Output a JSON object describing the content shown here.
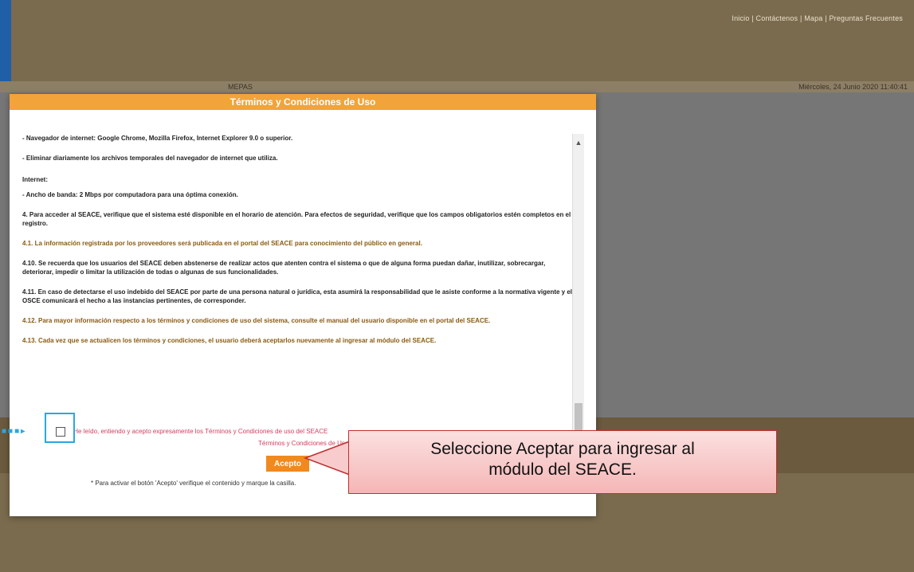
{
  "header": {
    "links": "Inicio | Contáctenos | Mapa | Preguntas Frecuentes",
    "left_label": "MEPAS",
    "date": "Miércoles, 24 Junio 2020 11:40:41"
  },
  "modal": {
    "title": "Términos y Condiciones de Uso",
    "paragraphs": [
      "- Navegador de internet: Google Chrome, Mozilla Firefox, Internet Explorer 9.0 o superior.",
      "- Eliminar diariamente los archivos temporales del navegador de internet que utiliza.",
      "Internet:",
      "- Ancho de banda: 2 Mbps por computadora para una óptima conexión.",
      "4. Para acceder al SEACE, verifique que el sistema esté disponible en el horario de atención. Para efectos de seguridad, verifique que los campos obligatorios estén completos en el registro.",
      "4.1. La información registrada por los proveedores será publicada en el portal del SEACE para conocimiento del público en general.",
      "4.10. Se recuerda que los usuarios del SEACE deben abstenerse de realizar actos que atenten contra el sistema o que de alguna forma puedan dañar, inutilizar, sobrecargar, deteriorar, impedir o limitar la utilización de todas o algunas de sus funcionalidades.",
      "4.11. En caso de detectarse el uso indebido del SEACE por parte de una persona natural o jurídica, esta asumirá la responsabilidad que le asiste conforme a la normativa vigente y el OSCE comunicará el hecho a las instancias pertinentes, de corresponder.",
      "4.12. Para mayor información respecto a los términos y condiciones de uso del sistema, consulte el manual del usuario disponible en el portal del SEACE.",
      "4.13. Cada vez que se actualicen los términos y condiciones, el usuario deberá aceptarlos nuevamente al ingresar al módulo del SEACE."
    ],
    "checkbox_label": "He leído, entiendo y acepto expresamente los Términos y Condiciones de uso del SEACE",
    "consult_link": "Términos y Condiciones de Uso",
    "accept_label": "Acepto",
    "note": "* Para activar el botón 'Acepto' verifique el contenido y marque la casilla."
  },
  "callout": {
    "line1": "Seleccione Aceptar para ingresar al",
    "line2": "módulo del SEACE."
  },
  "colors": {
    "header_orange": "#f2a33a",
    "accept_button": "#f08a1e",
    "highlight": "#2aa7e0",
    "callout_border": "#c03030"
  }
}
